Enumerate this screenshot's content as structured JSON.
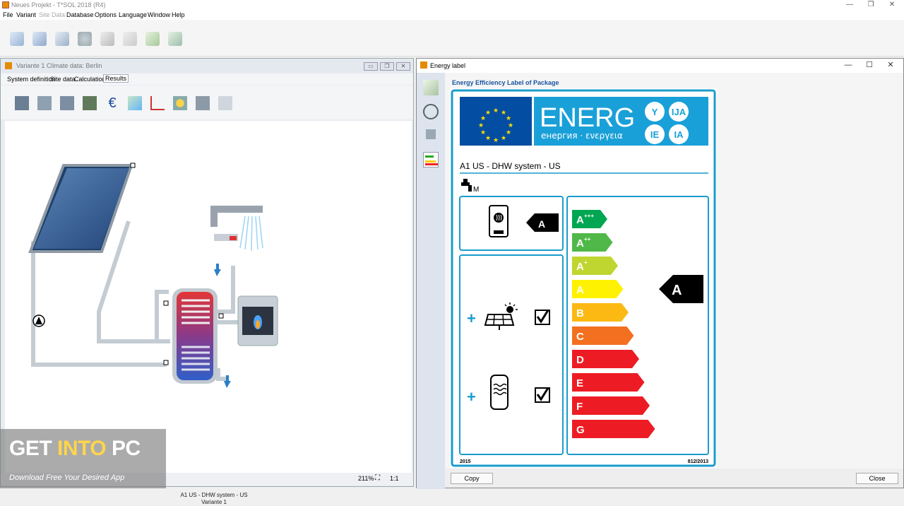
{
  "window": {
    "title": "Neues Projekt - T*SOL 2018 (R4)",
    "min": "—",
    "restore": "❐",
    "close": "✕"
  },
  "menu": [
    "File",
    "Variant",
    "Site Data",
    "Database",
    "Options",
    "Language",
    "Window",
    "Help"
  ],
  "variant_window": {
    "title": "Variante 1    Climate data: Berlin",
    "menu": [
      "System definition",
      "Site data",
      "Calculations",
      "Results"
    ],
    "diagram_caption_line1": "A1 US - DHW system - US",
    "diagram_caption_line2": "Variante 1",
    "zoom": "211%",
    "zoom_ratio": "1:1"
  },
  "energy_window": {
    "title": "Energy label",
    "heading": "Energy Efficiency Label of Package",
    "min": "—",
    "max": "☐",
    "close": "✕",
    "copy_label": "Copy",
    "close_label": "Close"
  },
  "label": {
    "energ": "ENERG",
    "energ_sub": "енергия · ενεργεια",
    "lang_codes": [
      "Y",
      "IJA",
      "IE",
      "IA"
    ],
    "system_name": "A1 US - DHW system - US",
    "load_profile": "M",
    "heater_class": "A",
    "package_class": "A",
    "year_left": "2015",
    "reg_right": "812/2013",
    "plus": "+",
    "scale": [
      {
        "label": "A",
        "sup": "+++",
        "color": "#00a651"
      },
      {
        "label": "A",
        "sup": "++",
        "color": "#50b848"
      },
      {
        "label": "A",
        "sup": "+",
        "color": "#bed62f"
      },
      {
        "label": "A",
        "sup": "",
        "color": "#fff200"
      },
      {
        "label": "B",
        "sup": "",
        "color": "#fdb913"
      },
      {
        "label": "C",
        "sup": "",
        "color": "#f37021"
      },
      {
        "label": "D",
        "sup": "",
        "color": "#ed1c24"
      },
      {
        "label": "E",
        "sup": "",
        "color": "#ed1c24"
      },
      {
        "label": "F",
        "sup": "",
        "color": "#ed1c24"
      },
      {
        "label": "G",
        "sup": "",
        "color": "#ed1c24"
      }
    ]
  },
  "watermark": {
    "get": "GET ",
    "into": "INTO",
    "pc": " PC",
    "tagline": "Download Free Your Desired App"
  },
  "colors": {
    "label_border": "#1a9ccc",
    "eu_blue": "#034ea2",
    "eu_star": "#ffdd00",
    "energ_bg": "#1aa0d8"
  }
}
